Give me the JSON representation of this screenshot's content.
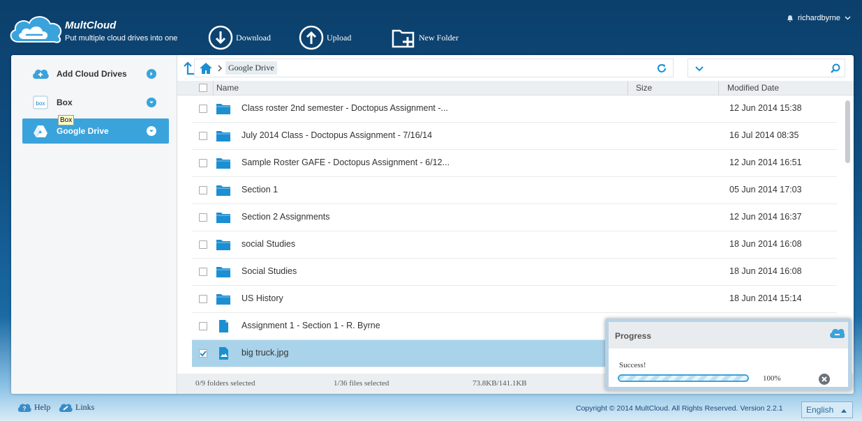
{
  "header": {
    "brand": "MultCloud",
    "tagline": "Put multiple cloud drives into one",
    "toolbar": [
      {
        "label": "Download",
        "icon": "download-icon"
      },
      {
        "label": "Upload",
        "icon": "upload-icon"
      },
      {
        "label": "New Folder",
        "icon": "new-folder-icon"
      }
    ],
    "user": "richardbyrne"
  },
  "sidebar": {
    "items": [
      {
        "label": "Add Cloud Drives",
        "icon": "add-cloud-icon"
      },
      {
        "label": "Box",
        "icon": "box-logo-icon"
      },
      {
        "label": "Google Drive",
        "icon": "google-drive-icon",
        "active": true
      }
    ],
    "tooltip": "Box"
  },
  "path": {
    "crumb": "Google Drive"
  },
  "table": {
    "headers": {
      "name": "Name",
      "size": "Size",
      "modified": "Modified Date"
    },
    "rows": [
      {
        "type": "folder",
        "name": "Class roster 2nd semester - Doctopus Assignment -...",
        "date": "12 Jun 2014 15:38"
      },
      {
        "type": "folder",
        "name": "July 2014 Class - Doctopus Assignment - 7/16/14",
        "date": "16 Jul 2014 08:35"
      },
      {
        "type": "folder",
        "name": "Sample Roster GAFE - Doctopus Assignment - 6/12...",
        "date": "12 Jun 2014 16:51"
      },
      {
        "type": "folder",
        "name": "Section 1",
        "date": "05 Jun 2014 17:03"
      },
      {
        "type": "folder",
        "name": "Section 2 Assignments",
        "date": "12 Jun 2014 16:37"
      },
      {
        "type": "folder",
        "name": "social Studies",
        "date": "18 Jun 2014 16:08"
      },
      {
        "type": "folder",
        "name": "Social Studies",
        "date": "18 Jun 2014 16:08"
      },
      {
        "type": "folder",
        "name": "US History",
        "date": "18 Jun 2014 15:14"
      },
      {
        "type": "doc",
        "name": "Assignment 1 - Section 1 - R. Byrne",
        "date": ""
      },
      {
        "type": "image",
        "name": "big truck.jpg",
        "date": "",
        "selected": true
      }
    ]
  },
  "status": {
    "folders": "0/9 folders selected",
    "files": "1/36 files selected",
    "size": "73.8KB/141.1KB"
  },
  "progress": {
    "title": "Progress",
    "message": "Success!",
    "percent_label": "100%",
    "value": 1.0
  },
  "footer": {
    "help": "Help",
    "links": "Links",
    "copyright": "Copyright © 2014 MultCloud. All Rights Reserved. Version 2.2.1",
    "language": "English"
  },
  "colors": {
    "accent": "#3aa3dc",
    "selected_row": "#a9d3ea",
    "folder": "#1b8fd2"
  }
}
